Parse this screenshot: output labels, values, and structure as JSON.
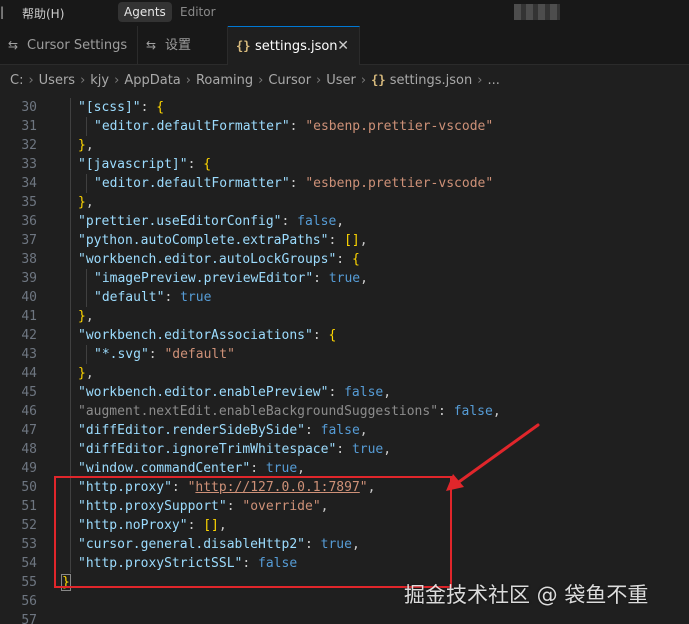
{
  "menubar": {
    "help": "帮助(H)",
    "modes": [
      {
        "label": "Agents",
        "active": true
      },
      {
        "label": "Editor",
        "active": false
      }
    ]
  },
  "tabs": [
    {
      "label": "Cursor Settings",
      "icon": "settings-gear-icon",
      "active": false
    },
    {
      "label": "设置",
      "icon": "settings-gear-icon",
      "active": false
    },
    {
      "label": "settings.json",
      "icon": "json-braces-icon",
      "active": true,
      "close_glyph": "✕"
    }
  ],
  "breadcrumb": [
    "C:",
    "Users",
    "kjy",
    "AppData",
    "Roaming",
    "Cursor",
    "User",
    "settings.json",
    "..."
  ],
  "editor": {
    "lines": [
      {
        "n": 30,
        "indent": 1,
        "tokens": [
          [
            "key",
            "\"[scss]\""
          ],
          [
            "punc",
            ": "
          ],
          [
            "br2",
            "{"
          ]
        ]
      },
      {
        "n": 31,
        "indent": 2,
        "tokens": [
          [
            "key",
            "\"editor.defaultFormatter\""
          ],
          [
            "punc",
            ": "
          ],
          [
            "str",
            "\"esbenp.prettier-vscode\""
          ]
        ]
      },
      {
        "n": 32,
        "indent": 1,
        "tokens": [
          [
            "br2",
            "}"
          ],
          [
            "punc",
            ","
          ]
        ]
      },
      {
        "n": 33,
        "indent": 1,
        "tokens": [
          [
            "key",
            "\"[javascript]\""
          ],
          [
            "punc",
            ": "
          ],
          [
            "br2",
            "{"
          ]
        ]
      },
      {
        "n": 34,
        "indent": 2,
        "tokens": [
          [
            "key",
            "\"editor.defaultFormatter\""
          ],
          [
            "punc",
            ": "
          ],
          [
            "str",
            "\"esbenp.prettier-vscode\""
          ]
        ]
      },
      {
        "n": 35,
        "indent": 1,
        "tokens": [
          [
            "br2",
            "}"
          ],
          [
            "punc",
            ","
          ]
        ]
      },
      {
        "n": 36,
        "indent": 1,
        "tokens": [
          [
            "key",
            "\"prettier.useEditorConfig\""
          ],
          [
            "punc",
            ": "
          ],
          [
            "kw",
            "false"
          ],
          [
            "punc",
            ","
          ]
        ]
      },
      {
        "n": 37,
        "indent": 1,
        "tokens": [
          [
            "key",
            "\"python.autoComplete.extraPaths\""
          ],
          [
            "punc",
            ": "
          ],
          [
            "br2",
            "[]"
          ],
          [
            "punc",
            ","
          ]
        ]
      },
      {
        "n": 38,
        "indent": 1,
        "tokens": [
          [
            "key",
            "\"workbench.editor.autoLockGroups\""
          ],
          [
            "punc",
            ": "
          ],
          [
            "br2",
            "{"
          ]
        ]
      },
      {
        "n": 39,
        "indent": 2,
        "tokens": [
          [
            "key",
            "\"imagePreview.previewEditor\""
          ],
          [
            "punc",
            ": "
          ],
          [
            "kw",
            "true"
          ],
          [
            "punc",
            ","
          ]
        ]
      },
      {
        "n": 40,
        "indent": 2,
        "tokens": [
          [
            "key",
            "\"default\""
          ],
          [
            "punc",
            ": "
          ],
          [
            "kw",
            "true"
          ]
        ]
      },
      {
        "n": 41,
        "indent": 1,
        "tokens": [
          [
            "br2",
            "}"
          ],
          [
            "punc",
            ","
          ]
        ]
      },
      {
        "n": 42,
        "indent": 1,
        "tokens": [
          [
            "key",
            "\"workbench.editorAssociations\""
          ],
          [
            "punc",
            ": "
          ],
          [
            "br2",
            "{"
          ]
        ]
      },
      {
        "n": 43,
        "indent": 2,
        "tokens": [
          [
            "key",
            "\"*.svg\""
          ],
          [
            "punc",
            ": "
          ],
          [
            "str",
            "\"default\""
          ]
        ]
      },
      {
        "n": 44,
        "indent": 1,
        "tokens": [
          [
            "br2",
            "}"
          ],
          [
            "punc",
            ","
          ]
        ]
      },
      {
        "n": 45,
        "indent": 1,
        "tokens": [
          [
            "key",
            "\"workbench.editor.enablePreview\""
          ],
          [
            "punc",
            ": "
          ],
          [
            "kw",
            "false"
          ],
          [
            "punc",
            ","
          ]
        ]
      },
      {
        "n": 46,
        "indent": 1,
        "tokens": [
          [
            "dim",
            "\"augment.nextEdit.enableBackgroundSuggestions\""
          ],
          [
            "punc",
            ": "
          ],
          [
            "kw",
            "false"
          ],
          [
            "punc",
            ","
          ]
        ]
      },
      {
        "n": 47,
        "indent": 1,
        "tokens": [
          [
            "key",
            "\"diffEditor.renderSideBySide\""
          ],
          [
            "punc",
            ": "
          ],
          [
            "kw",
            "false"
          ],
          [
            "punc",
            ","
          ]
        ]
      },
      {
        "n": 48,
        "indent": 1,
        "tokens": [
          [
            "key",
            "\"diffEditor.ignoreTrimWhitespace\""
          ],
          [
            "punc",
            ": "
          ],
          [
            "kw",
            "true"
          ],
          [
            "punc",
            ","
          ]
        ]
      },
      {
        "n": 49,
        "indent": 1,
        "tokens": [
          [
            "key",
            "\"window.commandCenter\""
          ],
          [
            "punc",
            ": "
          ],
          [
            "kw",
            "true"
          ],
          [
            "punc",
            ","
          ]
        ]
      },
      {
        "n": 50,
        "indent": 1,
        "tokens": [
          [
            "key",
            "\"http.proxy\""
          ],
          [
            "punc",
            ": "
          ],
          [
            "str",
            "\""
          ],
          [
            "link",
            "http://127.0.0.1:7897"
          ],
          [
            "str",
            "\""
          ],
          [
            "punc",
            ","
          ]
        ]
      },
      {
        "n": 51,
        "indent": 1,
        "tokens": [
          [
            "key",
            "\"http.proxySupport\""
          ],
          [
            "punc",
            ": "
          ],
          [
            "str",
            "\"override\""
          ],
          [
            "punc",
            ","
          ]
        ]
      },
      {
        "n": 52,
        "indent": 1,
        "tokens": [
          [
            "key",
            "\"http.noProxy\""
          ],
          [
            "punc",
            ": "
          ],
          [
            "br2",
            "[]"
          ],
          [
            "punc",
            ","
          ]
        ]
      },
      {
        "n": 53,
        "indent": 1,
        "tokens": [
          [
            "key",
            "\"cursor.general.disableHttp2\""
          ],
          [
            "punc",
            ": "
          ],
          [
            "kw",
            "true"
          ],
          [
            "punc",
            ","
          ]
        ]
      },
      {
        "n": 54,
        "indent": 1,
        "tokens": [
          [
            "key",
            "\"http.proxyStrictSSL\""
          ],
          [
            "punc",
            ": "
          ],
          [
            "kw",
            "false"
          ]
        ]
      },
      {
        "n": 55,
        "indent": 0,
        "tokens": [
          [
            "match",
            "}"
          ]
        ]
      },
      {
        "n": 56,
        "indent": 0,
        "tokens": []
      },
      {
        "n": 57,
        "indent": 0,
        "tokens": []
      }
    ]
  },
  "annotation": {
    "box_color": "#e0262b",
    "watermark": "掘金技术社区 @ 袋鱼不重"
  },
  "colors": {
    "background": "#1f1f1f",
    "json_key": "#9cdcfe",
    "json_string": "#ce9178",
    "json_keyword": "#569cd6",
    "bracket": "#ffd700",
    "tab_active_border": "#0078d4"
  }
}
